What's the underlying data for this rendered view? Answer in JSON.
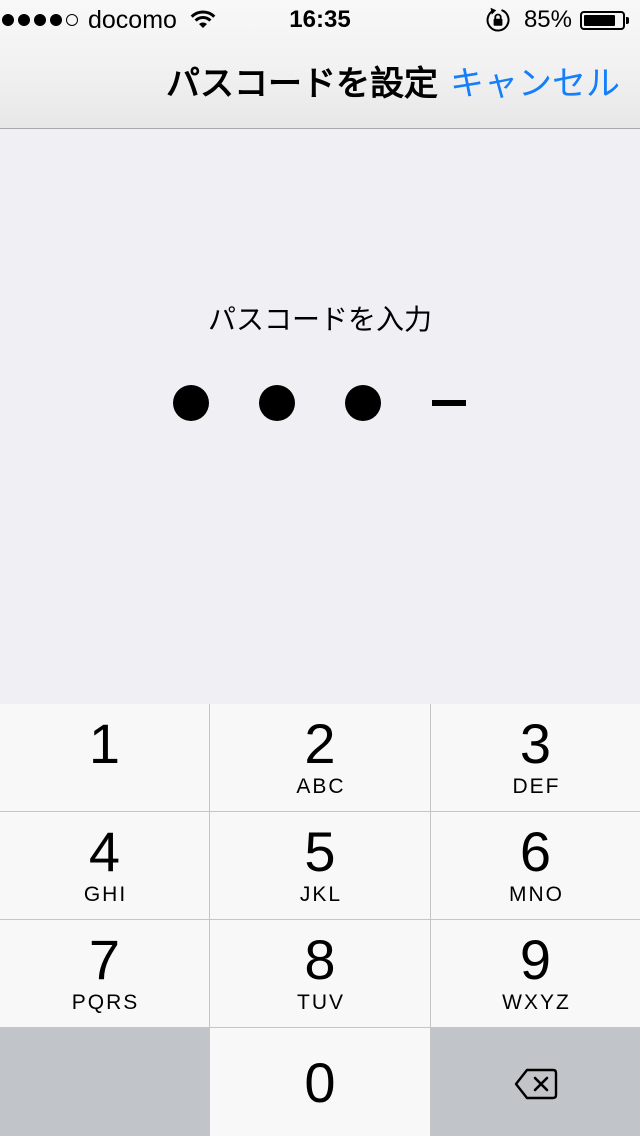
{
  "status_bar": {
    "signal_strength": 4,
    "signal_max": 5,
    "carrier": "docomo",
    "time": "16:35",
    "battery_text": "85%",
    "battery_level": 0.85
  },
  "nav_bar": {
    "title": "パスコードを設定",
    "cancel_label": "キャンセル"
  },
  "passcode_entry": {
    "prompt": "パスコードを入力",
    "digits_entered": 3,
    "digits_total": 4
  },
  "keypad": {
    "keys": [
      {
        "digit": "1"
      },
      {
        "digit": "2",
        "letters": "ABC"
      },
      {
        "digit": "3",
        "letters": "DEF"
      },
      {
        "digit": "4",
        "letters": "GHI"
      },
      {
        "digit": "5",
        "letters": "JKL"
      },
      {
        "digit": "6",
        "letters": "MNO"
      },
      {
        "digit": "7",
        "letters": "PQRS"
      },
      {
        "digit": "8",
        "letters": "TUV"
      },
      {
        "digit": "9",
        "letters": "WXYZ"
      },
      {
        "digit": "0"
      }
    ]
  },
  "icons": {
    "wifi": "wifi-icon",
    "orientation_lock": "rotation-lock-icon",
    "battery": "battery-icon",
    "delete": "backspace-icon"
  },
  "colors": {
    "accent": "#157efb",
    "background": "#efeff4",
    "key": "#f8f8f9",
    "key_dark": "#c1c4c9",
    "separator": "#c4c5c8",
    "text": "#000000"
  }
}
